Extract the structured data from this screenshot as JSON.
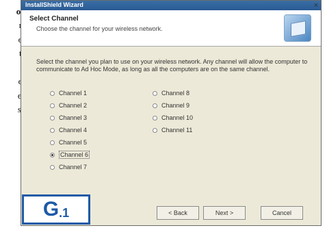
{
  "left_text": [
    "oc",
    "r-",
    "el",
    "t-",
    "u",
    "et",
    "er",
    "ss"
  ],
  "window": {
    "title": "InstallShield Wizard",
    "close_glyph": "×"
  },
  "header": {
    "title": "Select Channel",
    "subtitle": "Choose the channel for your wireless network."
  },
  "description": "Select the channel you plan to use on your wireless network. Any channel will allow the computer to communicate to Ad Hoc Mode, as long as all the computers are on the same channel.",
  "channels_left": [
    {
      "label": "Channel 1",
      "selected": false
    },
    {
      "label": "Channel 2",
      "selected": false
    },
    {
      "label": "Channel 3",
      "selected": false
    },
    {
      "label": "Channel 4",
      "selected": false
    },
    {
      "label": "Channel 5",
      "selected": false
    },
    {
      "label": "Channel 6",
      "selected": true
    },
    {
      "label": "Channel 7",
      "selected": false
    }
  ],
  "channels_right": [
    {
      "label": "Channel 8",
      "selected": false
    },
    {
      "label": "Channel 9",
      "selected": false
    },
    {
      "label": "Channel 10",
      "selected": false
    },
    {
      "label": "Channel 11",
      "selected": false
    }
  ],
  "buttons": {
    "back": "< Back",
    "next": "Next >",
    "cancel": "Cancel"
  },
  "figure_label": {
    "letter": "G",
    "number": ".1"
  },
  "colors": {
    "title_bar": "#2a5a94",
    "figure_border": "#1c5aa6",
    "dialog_bg": "#ece9d8"
  }
}
